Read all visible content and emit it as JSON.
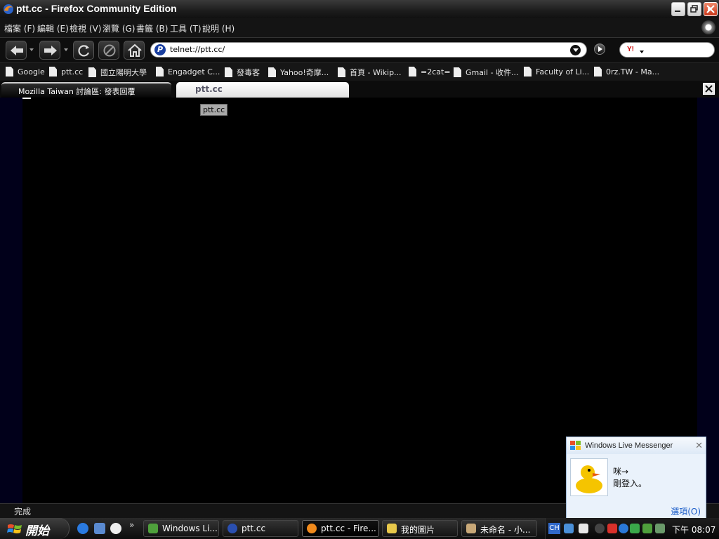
{
  "window": {
    "title": "ptt.cc - Firefox Community Edition"
  },
  "menu": [
    "檔案 (F)",
    "編輯 (E)",
    "檢視 (V)",
    "瀏覽 (G)",
    "書籤 (B)",
    "工具 (T)",
    "說明 (H)"
  ],
  "nav": {
    "url": "telnet://ptt.cc/",
    "search_engine": "Y!"
  },
  "bookmarks": [
    "Google",
    "ptt.cc",
    "國立陽明大學",
    "Engadget C...",
    "發毒客",
    "Yahoo!奇摩...",
    "首頁 - Wikip...",
    "=2cat=",
    "Gmail - 收件...",
    "Faculty of Li...",
    "0rz.TW - Ma..."
  ],
  "tabs": [
    {
      "label": "Mozilla Taiwan 討論區: 發表回覆",
      "active": false
    },
    {
      "label": "ptt.cc",
      "active": true
    }
  ],
  "tooltip": "ptt.cc",
  "status": "完成",
  "messenger": {
    "title": "Windows Live Messenger",
    "line1": "咪→",
    "line2": "剛登入。",
    "options": "選項(O)"
  },
  "taskbar": {
    "start": "開始",
    "tasks": [
      "Windows Li...",
      "ptt.cc",
      "ptt.cc - Fire...",
      "我的圖片",
      "未命名 - 小..."
    ],
    "tray_lang": "CH",
    "clock": "下午 08:07"
  },
  "colors": {
    "accent": "#1a3fa0",
    "sidebar_bg": "#01001a",
    "link": "#1a5cc8"
  }
}
